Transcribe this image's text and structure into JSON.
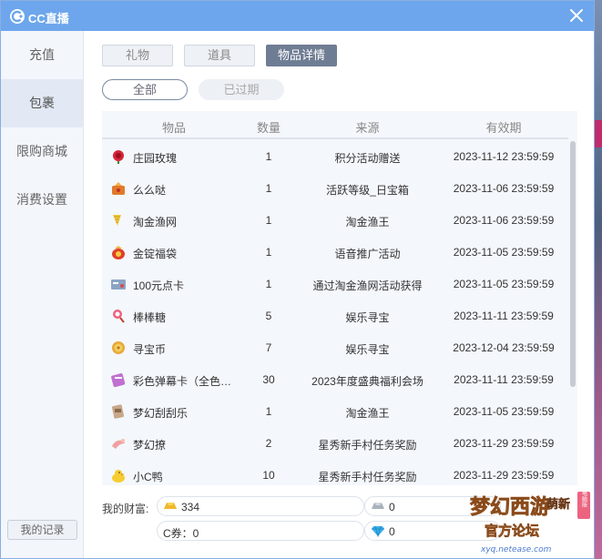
{
  "window": {
    "title": "CC直播"
  },
  "sidebar": {
    "items": [
      {
        "label": "充值",
        "active": false
      },
      {
        "label": "包裹",
        "active": true
      },
      {
        "label": "限购商城",
        "active": false
      },
      {
        "label": "消费设置",
        "active": false
      }
    ],
    "record_button": "我的记录"
  },
  "tabs": [
    {
      "label": "礼物",
      "active": false
    },
    {
      "label": "道具",
      "active": false
    },
    {
      "label": "物品详情",
      "active": true
    }
  ],
  "subtabs": [
    {
      "label": "全部",
      "active": true
    },
    {
      "label": "已过期",
      "active": false
    }
  ],
  "table": {
    "headers": [
      "物品",
      "数量",
      "来源",
      "有效期"
    ],
    "rows": [
      {
        "icon": "rose-icon",
        "name": "庄园玫瑰",
        "qty": "1",
        "source": "积分活动赠送",
        "expiry": "2023-11-12 23:59:59"
      },
      {
        "icon": "kiss-icon",
        "name": "么么哒",
        "qty": "1",
        "source": "活跃等级_日宝箱",
        "expiry": "2023-11-06 23:59:59"
      },
      {
        "icon": "fishing-net-icon",
        "name": "淘金渔网",
        "qty": "1",
        "source": "淘金渔王",
        "expiry": "2023-11-06 23:59:59"
      },
      {
        "icon": "lucky-bag-icon",
        "name": "金锭福袋",
        "qty": "1",
        "source": "语音推广活动",
        "expiry": "2023-11-05 23:59:59"
      },
      {
        "icon": "card-icon",
        "name": "100元点卡",
        "qty": "1",
        "source": "通过淘金渔网活动获得",
        "expiry": "2023-11-05 23:59:59"
      },
      {
        "icon": "lollipop-icon",
        "name": "棒棒糖",
        "qty": "5",
        "source": "娱乐寻宝",
        "expiry": "2023-11-11 23:59:59"
      },
      {
        "icon": "coin-icon",
        "name": "寻宝币",
        "qty": "7",
        "source": "娱乐寻宝",
        "expiry": "2023-12-04 23:59:59"
      },
      {
        "icon": "danmaku-card-icon",
        "name": "彩色弹幕卡（全色…",
        "qty": "30",
        "source": "2023年度盛典福利会场",
        "expiry": "2023-11-11 23:59:59"
      },
      {
        "icon": "scratch-card-icon",
        "name": "梦幻刮刮乐",
        "qty": "1",
        "source": "淘金渔王",
        "expiry": "2023-11-05 23:59:59"
      },
      {
        "icon": "hug-icon",
        "name": "梦幻撩",
        "qty": "2",
        "source": "星秀新手村任务奖励",
        "expiry": "2023-11-29 23:59:59"
      },
      {
        "icon": "duck-icon",
        "name": "小C鸭",
        "qty": "10",
        "source": "星秀新手村任务奖励",
        "expiry": "2023-11-29 23:59:59"
      }
    ]
  },
  "wealth": {
    "label": "我的财富:",
    "gold": "334",
    "silver": "0",
    "c_coupon_label": "C券：0",
    "diamond": "0"
  },
  "watermark": {
    "line1": "梦幻西游",
    "line2": "官方论坛",
    "url": "xyq.netease.com",
    "badge": "电脑版",
    "side": "萌新"
  }
}
